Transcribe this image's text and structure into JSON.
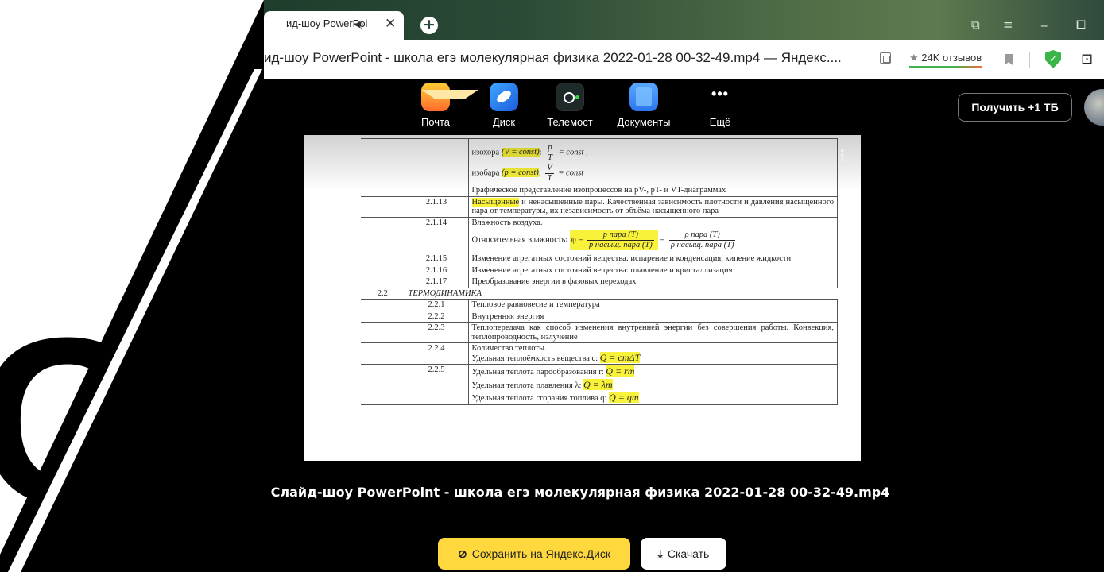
{
  "browser": {
    "tab_title": "ид-шоу PowerPoi",
    "tab_speaker": "◀)",
    "tab_close": "✕",
    "new_tab": "+",
    "win_icons": {
      "tabs": "⧉",
      "menu": "≡",
      "minimize": "_",
      "restore": "⧠"
    },
    "address_title": "ид-шоу PowerPoint - школа егэ молекулярная физика 2022-01-28 00-32-49.mp4 — Яндекс....",
    "reviews": "24K отзывов",
    "reviews_star": "★",
    "shield_mark": "✓",
    "ext": "⊡"
  },
  "disk_nav": {
    "apps": [
      {
        "label": "Почта",
        "icon": "mail-icon"
      },
      {
        "label": "Диск",
        "icon": "disk-icon"
      },
      {
        "label": "Телемост",
        "icon": "telemost-icon"
      },
      {
        "label": "Документы",
        "icon": "documents-icon"
      },
      {
        "label": "Ещё",
        "icon": "more-icon"
      }
    ],
    "more_glyph": "•••",
    "get_storage": "Получить +1 ТБ"
  },
  "background_logo": "СК",
  "document": {
    "rows": {
      "r0_isochor": "изохора",
      "r0_isochor_cond": "(V = const)",
      "r0_isochor_num": "p",
      "r0_isochor_den": "T",
      "r0_isochor_rhs": "= const ,",
      "r0_isobar": "изобара",
      "r0_isobar_cond": "(p = const)",
      "r0_isobar_num": "V",
      "r0_isobar_den": "T",
      "r0_isobar_rhs": "= const",
      "r0_graph": "Графическое представление изопроцессов на pV-, pT- и VT-диаграммах",
      "r1_num": "2.1.13",
      "r1_hl": "Насыщенные",
      "r1_text": " и ненасыщенные пары. Качественная зависимость плотности и давления насыщенного пара от температуры, их независимость от объёма насыщенного пара",
      "r2_num": "2.1.14",
      "r2_l1": "Влажность воздуха.",
      "r2_l2": "Относительная влажность:",
      "r2_phi": "φ =",
      "r2_n1": "p пара (T)",
      "r2_d1": "p насыщ. пара (T)",
      "r2_eq": "=",
      "r2_n2": "ρ пара (T)",
      "r2_d2": "ρ насыщ. пара (T)",
      "r3_num": "2.1.15",
      "r3_text": "Изменение агрегатных состояний вещества: испарение и конденсация, кипение жидкости",
      "r4_num": "2.1.16",
      "r4_text": "Изменение агрегатных состояний вещества: плавление и кристаллизация",
      "r5_num": "2.1.17",
      "r5_text": "Преобразование энергии в фазовых переходах",
      "r6_num": "2.2",
      "r6_text": "ТЕРМОДИНАМИКА",
      "r7_num": "2.2.1",
      "r7_text": "Тепловое равновесие и температура",
      "r8_num": "2.2.2",
      "r8_text": "Внутренняя энергия",
      "r9_num": "2.2.3",
      "r9_text": "Теплопередача как способ изменения внутренней энергии без совершения работы. Конвекция, теплопроводность, излучение",
      "r10_num": "2.2.4",
      "r10_l1": "Количество теплоты.",
      "r10_l2": "Удельная теплоёмкость вещества c:",
      "r10_f": "Q = cmΔT",
      "r11_num": "2.2.5",
      "r11_l1": "Удельная теплота парообразования r:",
      "r11_f1": "Q = rm",
      "r11_l2": "Удельная теплота плавления λ:",
      "r11_f2": "Q = λm",
      "r11_l3": "Удельная теплота сгорания топлива q:",
      "r11_f3": "Q = qm"
    }
  },
  "video_title": "Слайд-шоу PowerPoint - школа егэ молекулярная физика 2022-01-28 00-32-49.mp4",
  "actions": {
    "save": "Сохранить на Яндекс.Диск",
    "download": "Скачать",
    "save_glyph": "⊘",
    "download_glyph": "⤓"
  },
  "colors": {
    "save_button": "#ffd83d",
    "highlight": "#f8f23a",
    "panel": "#000000"
  }
}
